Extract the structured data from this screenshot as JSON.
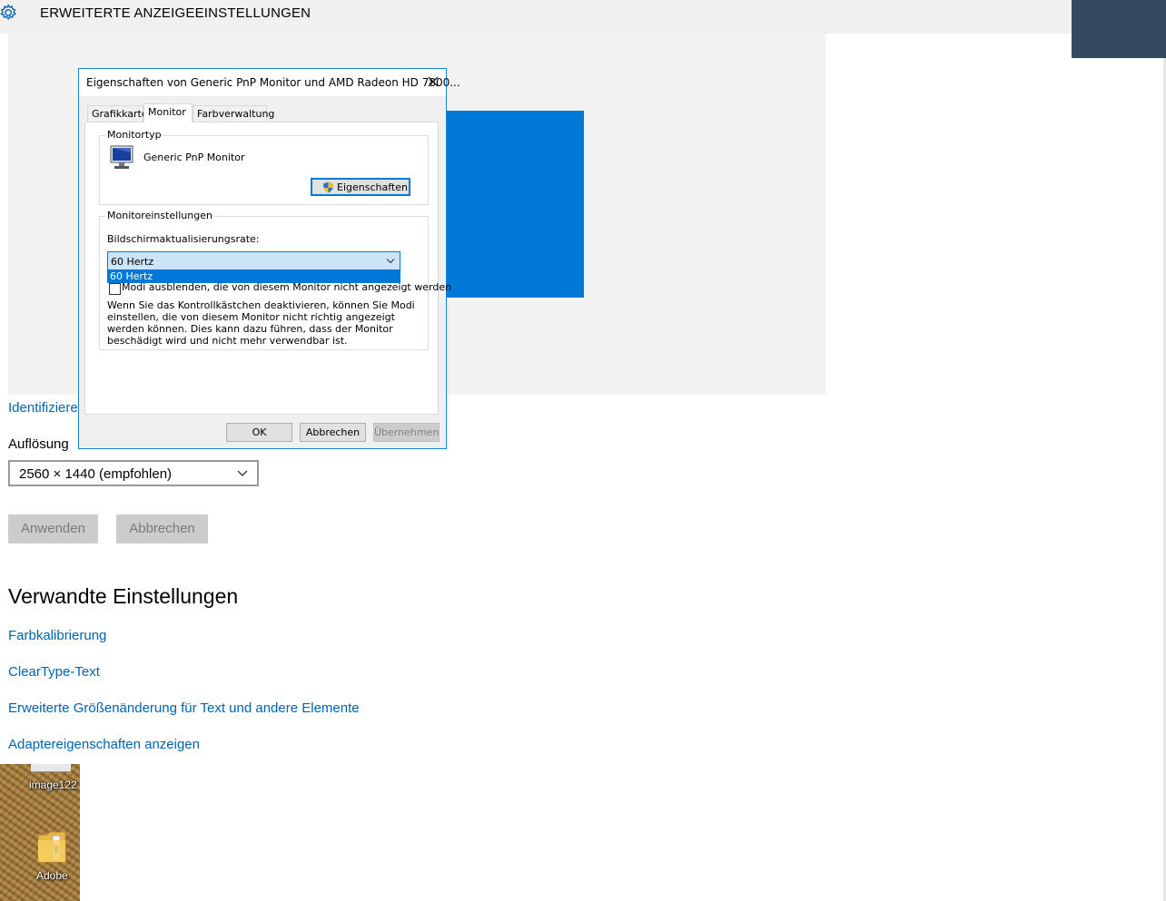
{
  "window": {
    "title": "ERWEITERTE ANZEIGEEINSTELLUNGEN"
  },
  "main": {
    "identify_link": "Identifiziere",
    "resolution_label": "Auflösung",
    "resolution_value": "2560 × 1440 (empfohlen)",
    "apply_button": "Anwenden",
    "cancel_button": "Abbrechen",
    "related_title": "Verwandte Einstellungen",
    "related_links": [
      "Farbkalibrierung",
      "ClearType-Text",
      "Erweiterte Größenänderung für Text und andere Elemente",
      "Adaptereigenschaften anzeigen"
    ]
  },
  "desktop": {
    "icons": [
      "image122",
      "Adobe"
    ]
  },
  "dialog": {
    "title": "Eigenschaften von Generic PnP Monitor und AMD Radeon HD 7800...",
    "tabs": [
      "Grafikkarte",
      "Monitor",
      "Farbverwaltung"
    ],
    "active_tab": "Monitor",
    "monitor_type_group": "Monitortyp",
    "monitor_name": "Generic PnP Monitor",
    "properties_button": "Eigenschaften",
    "monitor_settings_group": "Monitoreinstellungen",
    "refresh_rate_label": "Bildschirmaktualisierungsrate:",
    "refresh_rate_value": "60 Hertz",
    "refresh_rate_options": [
      "60 Hertz"
    ],
    "hide_modes_label": "Modi ausblenden, die von diesem Monitor nicht angezeigt werden",
    "warning_text": "Wenn Sie das Kontrollkästchen deaktivieren, können Sie Modi einstellen, die von diesem Monitor nicht richtig angezeigt werden können. Dies kann dazu führen, dass der Monitor beschädigt wird und nicht mehr verwendbar ist.",
    "ok_button": "OK",
    "cancel_button": "Abbrechen",
    "apply_button": "Übernehmen"
  },
  "colors": {
    "accent": "#0078d7",
    "link": "#0063b1",
    "corner": "#34495e"
  }
}
